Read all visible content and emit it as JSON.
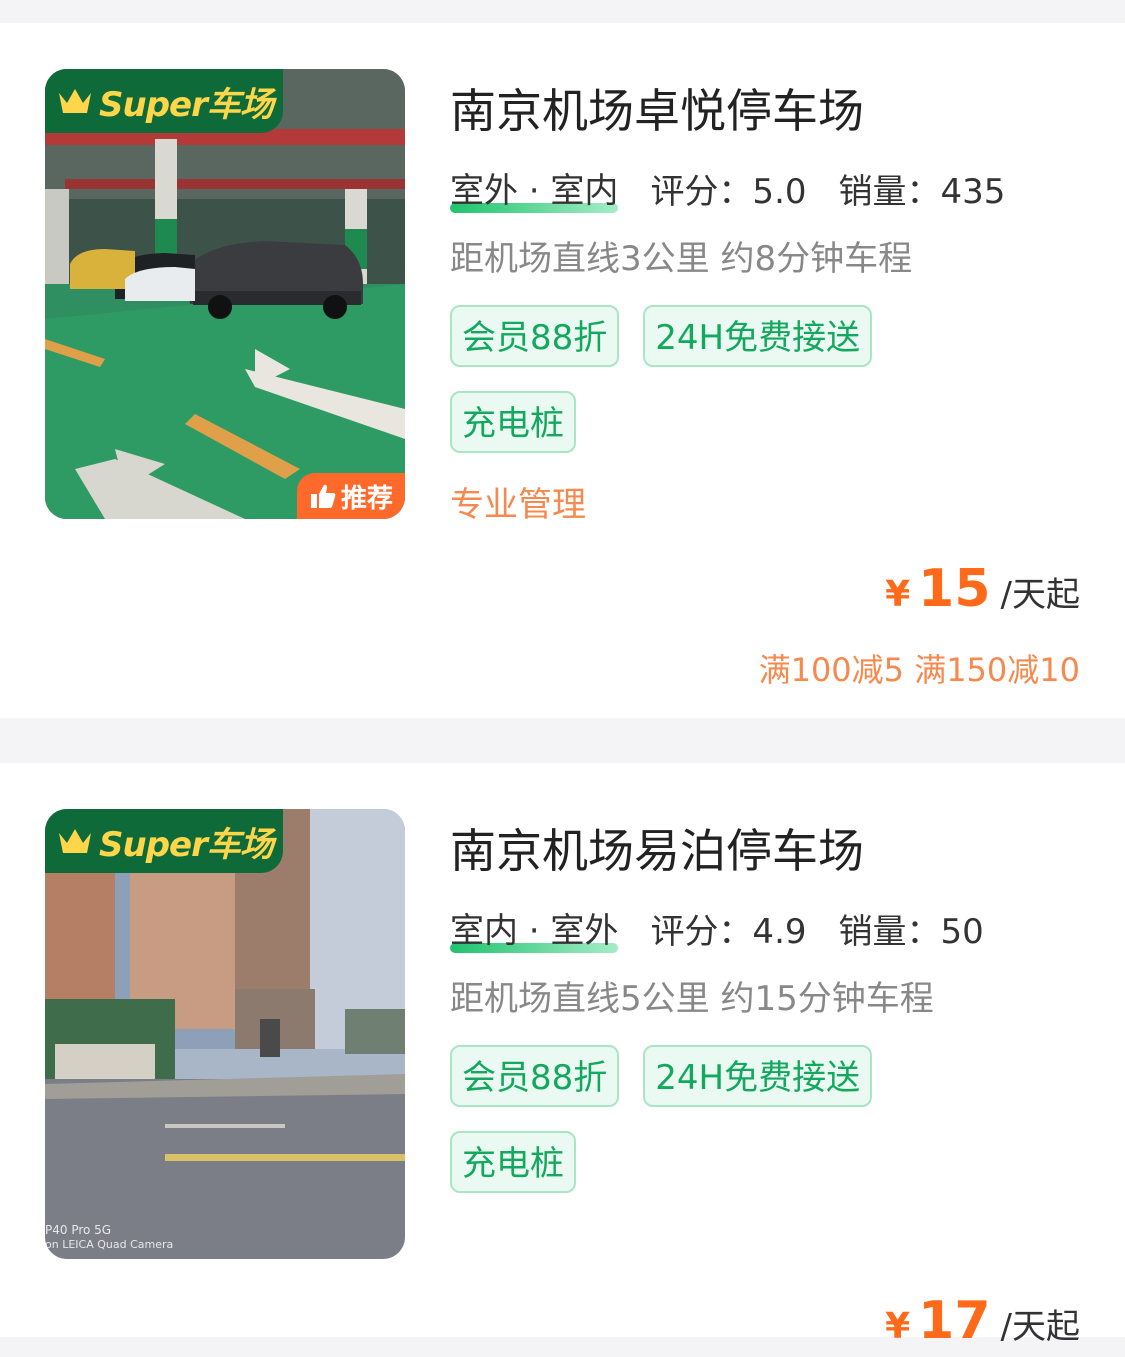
{
  "lots": [
    {
      "badge": "Super车场",
      "recommend_label": "推荐",
      "title": "南京机场卓悦停车场",
      "location_type": "室外 · 室内",
      "rating_label": "评分：5.0",
      "sales_label": "销量：435",
      "distance": "距机场直线3公里 约8分钟车程",
      "tags": [
        "会员88折",
        "24H免费接送",
        "充电桩"
      ],
      "feature": "专业管理",
      "price_currency": "¥",
      "price_value": "15",
      "price_unit": "/天起",
      "promo": "满100减5 满150减10"
    },
    {
      "badge": "Super车场",
      "title": "南京机场易泊停车场",
      "location_type": "室内 · 室外",
      "rating_label": "评分：4.9",
      "sales_label": "销量：50",
      "distance": "距机场直线5公里 约15分钟车程",
      "tags": [
        "会员88折",
        "24H免费接送",
        "充电桩"
      ],
      "price_currency": "¥",
      "price_value": "17",
      "price_unit": "/天起",
      "photo_watermark": [
        "P40 Pro 5G",
        "on LEICA Quad Camera"
      ]
    }
  ],
  "colors": {
    "accent_green": "#14a85f",
    "badge_green": "#0f6a3a",
    "price_orange": "#ff6a1a",
    "promo_orange": "#f5894e"
  }
}
